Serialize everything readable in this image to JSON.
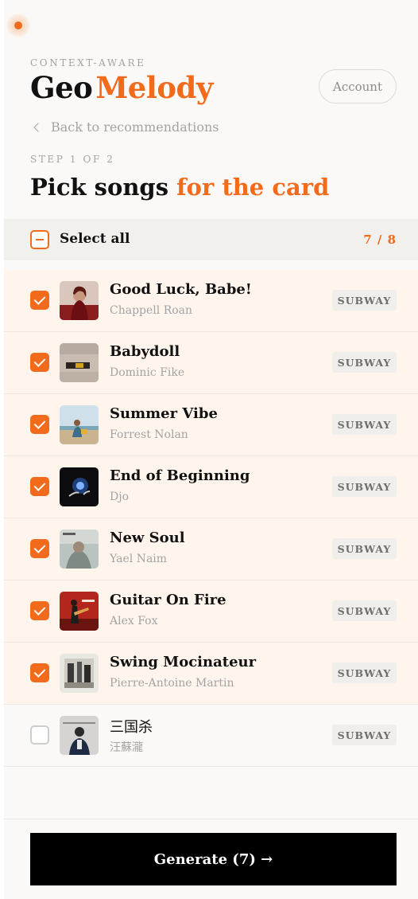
{
  "header": {
    "kicker": "CONTEXT-AWARE",
    "logo_part1": "Geo",
    "logo_part2": "Melody",
    "account_label": "Account"
  },
  "nav": {
    "back_label": "Back to recommendations"
  },
  "step": {
    "label": "STEP 1 OF 2",
    "title_part1": "Pick songs ",
    "title_part2": "for the card"
  },
  "selection": {
    "select_all_label": "Select all",
    "count": "7 / 8"
  },
  "songs": [
    {
      "title": "Good Luck, Babe!",
      "artist": "Chappell Roan",
      "tag": "SUBWAY",
      "selected": true,
      "art_icon": "album-cover"
    },
    {
      "title": "Babydoll",
      "artist": "Dominic Fike",
      "tag": "SUBWAY",
      "selected": true,
      "art_icon": "album-cover"
    },
    {
      "title": "Summer Vibe",
      "artist": "Forrest Nolan",
      "tag": "SUBWAY",
      "selected": true,
      "art_icon": "album-cover"
    },
    {
      "title": "End of Beginning",
      "artist": "Djo",
      "tag": "SUBWAY",
      "selected": true,
      "art_icon": "album-cover"
    },
    {
      "title": "New Soul",
      "artist": "Yael Naim",
      "tag": "SUBWAY",
      "selected": true,
      "art_icon": "album-cover"
    },
    {
      "title": "Guitar On Fire",
      "artist": "Alex Fox",
      "tag": "SUBWAY",
      "selected": true,
      "art_icon": "album-cover"
    },
    {
      "title": "Swing Mocinateur",
      "artist": "Pierre-Antoine Martin",
      "tag": "SUBWAY",
      "selected": true,
      "art_icon": "album-cover"
    },
    {
      "title": "三国杀",
      "artist": "汪蘇瀧",
      "tag": "SUBWAY",
      "selected": false,
      "art_icon": "album-cover"
    }
  ],
  "footer": {
    "generate_label": "Generate (7) →"
  },
  "colors": {
    "accent": "#f26a1b",
    "selected_row_bg": "#fff5ed",
    "page_bg": "#faf9f7",
    "button_bg": "#000000"
  }
}
